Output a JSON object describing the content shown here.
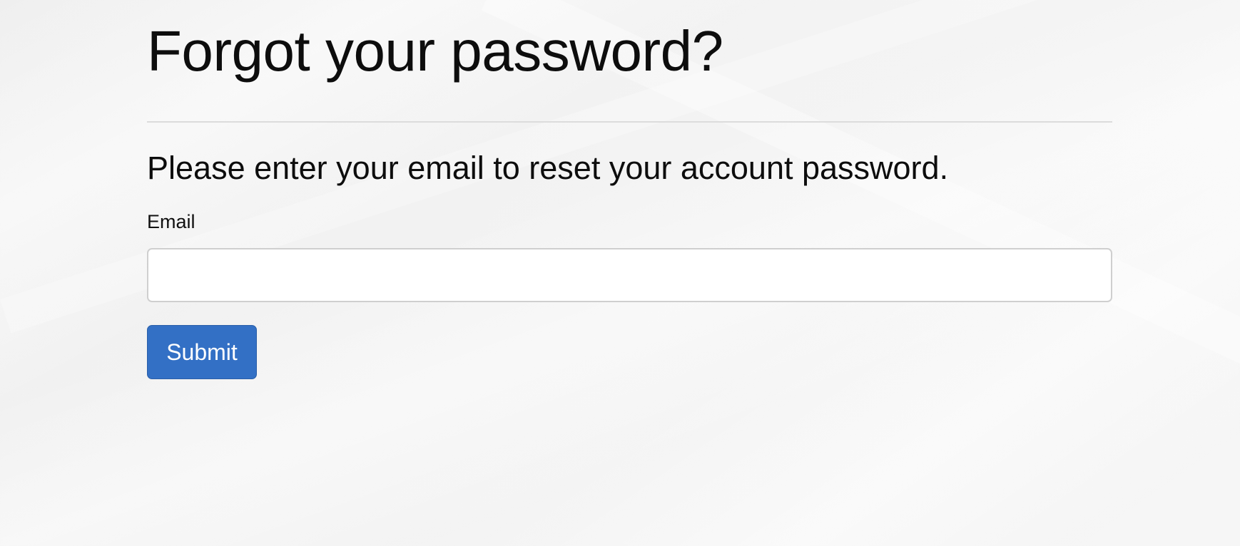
{
  "page": {
    "title": "Forgot your password?",
    "subtitle": "Please enter your email to reset your account password."
  },
  "form": {
    "email_label": "Email",
    "email_value": "",
    "email_placeholder": "",
    "submit_label": "Submit"
  },
  "colors": {
    "primary_button": "#3370c5",
    "background": "#f3f3f3"
  }
}
